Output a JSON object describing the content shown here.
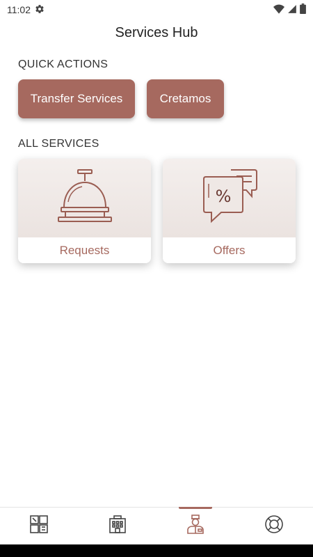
{
  "status": {
    "time": "11:02"
  },
  "header": {
    "title": "Services Hub"
  },
  "quick_actions": {
    "label": "QUICK ACTIONS",
    "buttons": [
      {
        "label": "Transfer Services"
      },
      {
        "label": "Cretamos"
      }
    ]
  },
  "all_services": {
    "label": "ALL SERVICES",
    "cards": [
      {
        "label": "Requests",
        "icon": "service-bell-icon"
      },
      {
        "label": "Offers",
        "icon": "discount-chat-icon"
      }
    ]
  },
  "bottom_nav": {
    "items": [
      {
        "icon": "dashboard-icon",
        "active": false
      },
      {
        "icon": "hotel-icon",
        "active": false
      },
      {
        "icon": "concierge-icon",
        "active": true
      },
      {
        "icon": "lifebuoy-icon",
        "active": false
      }
    ]
  },
  "colors": {
    "accent": "#a6695f",
    "card_bg": "#efe8e5"
  }
}
